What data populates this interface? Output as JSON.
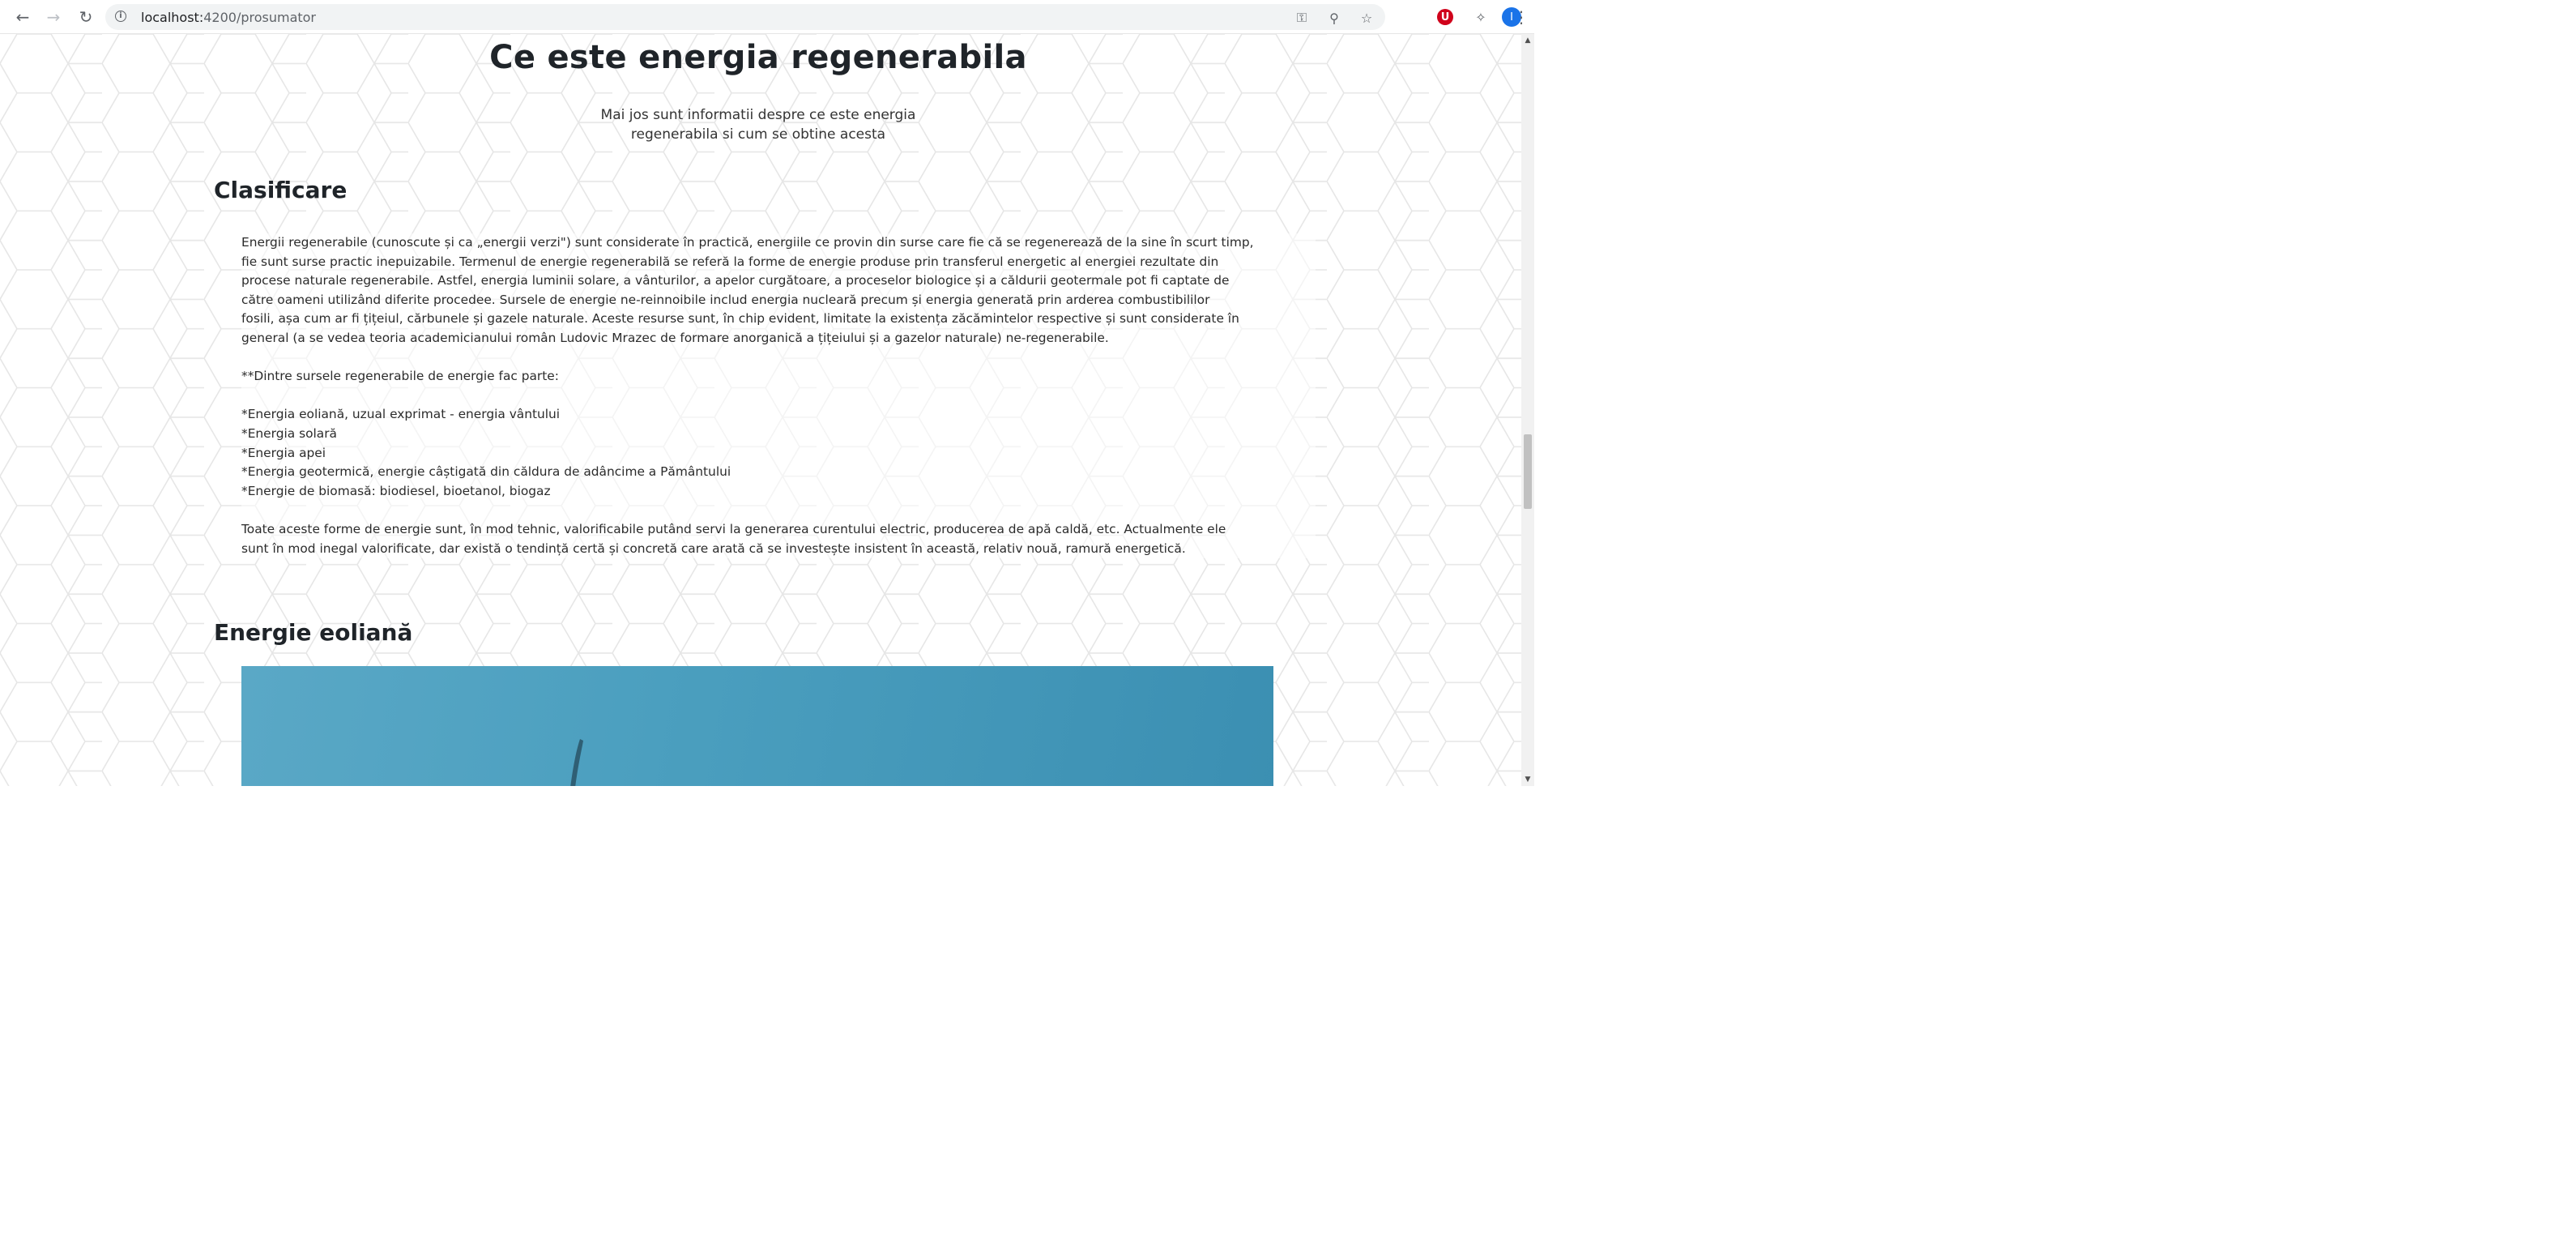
{
  "browser": {
    "url_host": "localhost:",
    "url_path": "4200/prosumator",
    "profile_initial": "I",
    "extension_badge": "U"
  },
  "page": {
    "title": "Ce este energia regenerabila",
    "subtitle_line1": "Mai jos sunt informatii despre ce este energia",
    "subtitle_line2": "regenerabila si cum se obtine acesta",
    "section1_title": "Clasificare",
    "section1_paragraph_lines": [
      "Energii regenerabile (cunoscute și ca „energii verzi\") sunt considerate în practică, energiile ce provin din surse care fie că se regenerează de la sine în scurt timp,",
      "fie sunt surse practic inepuizabile. Termenul de energie regenerabilă se referă la forme de energie produse prin transferul energetic al energiei rezultate din",
      "procese naturale regenerabile. Astfel, energia luminii solare, a vânturilor, a apelor curgătoare, a proceselor biologice și a căldurii geotermale pot fi captate de",
      "către oameni utilizând diferite procedee. Sursele de energie ne-reinnoibile includ energia nucleară precum și energia generată prin arderea combustibililor",
      "fosili, așa cum ar fi țițeiul, cărbunele și gazele naturale. Aceste resurse sunt, în chip evident, limitate la existența zăcămintelor respective și sunt considerate în",
      "general (a se vedea teoria academicianului român Ludovic Mrazec de formare anorganică a țițeiului și a gazelor naturale) ne-regenerabile."
    ],
    "sources_intro": "**Dintre sursele regenerabile de energie fac parte:",
    "sources": [
      "*Energia eoliană, uzual exprimat - energia vântului",
      "*Energia solară",
      "*Energia apei",
      "*Energia geotermică, energie câștigată din căldura de adâncime a Pământului",
      "*Energie de biomasă: biodiesel, bioetanol, biogaz"
    ],
    "closing_lines": [
      "Toate aceste forme de energie sunt, în mod tehnic, valorificabile putând servi la generarea curentului electric, producerea de apă caldă, etc. Actualmente ele",
      "sunt în mod inegal valorificate, dar există o tendință certă și concretă care arată că se investește insistent în această, relativ nouă, ramură energetică."
    ],
    "section2_title": "Energie eoliană"
  },
  "colors": {
    "heading": "#1f2429",
    "body": "#2b2b2b",
    "sky": "#4b9fbf"
  },
  "icons": [
    "back-icon",
    "forward-icon",
    "reload-icon",
    "info-icon",
    "key-icon",
    "zoom-icon",
    "star-icon",
    "opera-icon",
    "extensions-icon",
    "avatar",
    "menu-icon"
  ]
}
